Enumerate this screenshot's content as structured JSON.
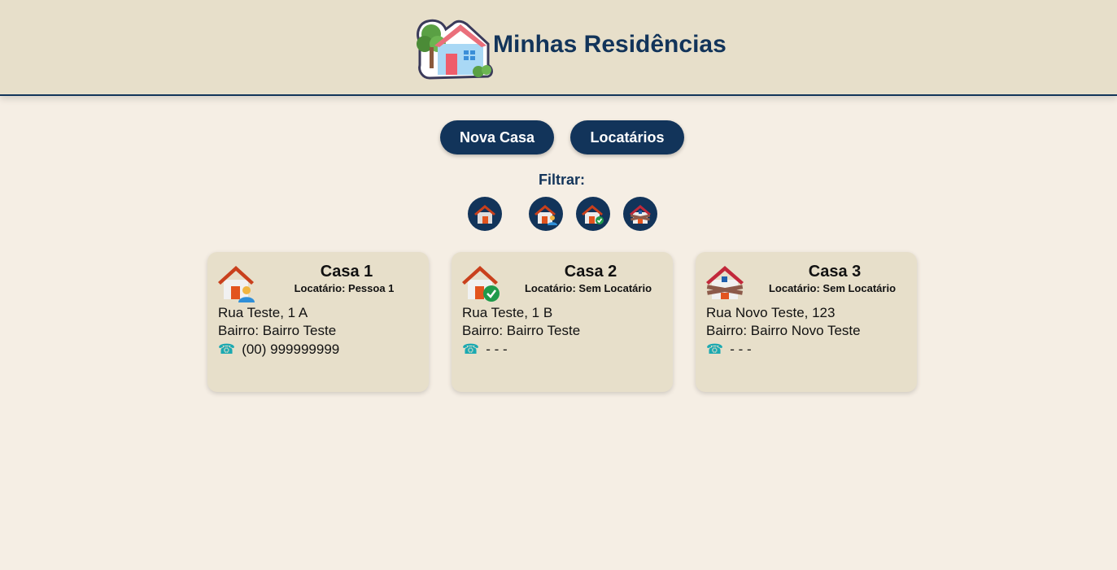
{
  "header": {
    "title": "Minhas Residências",
    "logo_icon": "house-tree-logo-icon"
  },
  "actions": {
    "nova_casa_label": "Nova Casa",
    "locatarios_label": "Locatários"
  },
  "filter": {
    "label": "Filtrar:",
    "options": [
      {
        "icon": "house-all-icon"
      },
      {
        "icon": "house-rented-icon"
      },
      {
        "icon": "house-available-icon"
      },
      {
        "icon": "house-closed-icon"
      }
    ]
  },
  "cards": [
    {
      "title": "Casa 1",
      "tenant": "Locatário: Pessoa 1",
      "street": "Rua Teste, 1 A",
      "neighborhood": "Bairro: Bairro Teste",
      "phone_icon": "☎",
      "phone": "(00) 999999999",
      "status_icon": "house-rented-icon"
    },
    {
      "title": "Casa 2",
      "tenant": "Locatário: Sem Locatário",
      "street": "Rua Teste, 1 B",
      "neighborhood": "Bairro: Bairro Teste",
      "phone_icon": "☎",
      "phone": "- - -",
      "status_icon": "house-available-icon"
    },
    {
      "title": "Casa 3",
      "tenant": "Locatário: Sem Locatário",
      "street": "Rua Novo Teste, 123",
      "neighborhood": "Bairro: Bairro Novo Teste",
      "phone_icon": "☎",
      "phone": "- - -",
      "status_icon": "house-closed-icon"
    }
  ],
  "colors": {
    "primary": "#12345a",
    "header_bg": "#e7dfca",
    "page_bg": "#f5eee4",
    "card_bg": "#e7dfca",
    "roof": "#c9401c",
    "door": "#e2541f",
    "check": "#1e9a4b",
    "phone": "#1ba9b1"
  }
}
